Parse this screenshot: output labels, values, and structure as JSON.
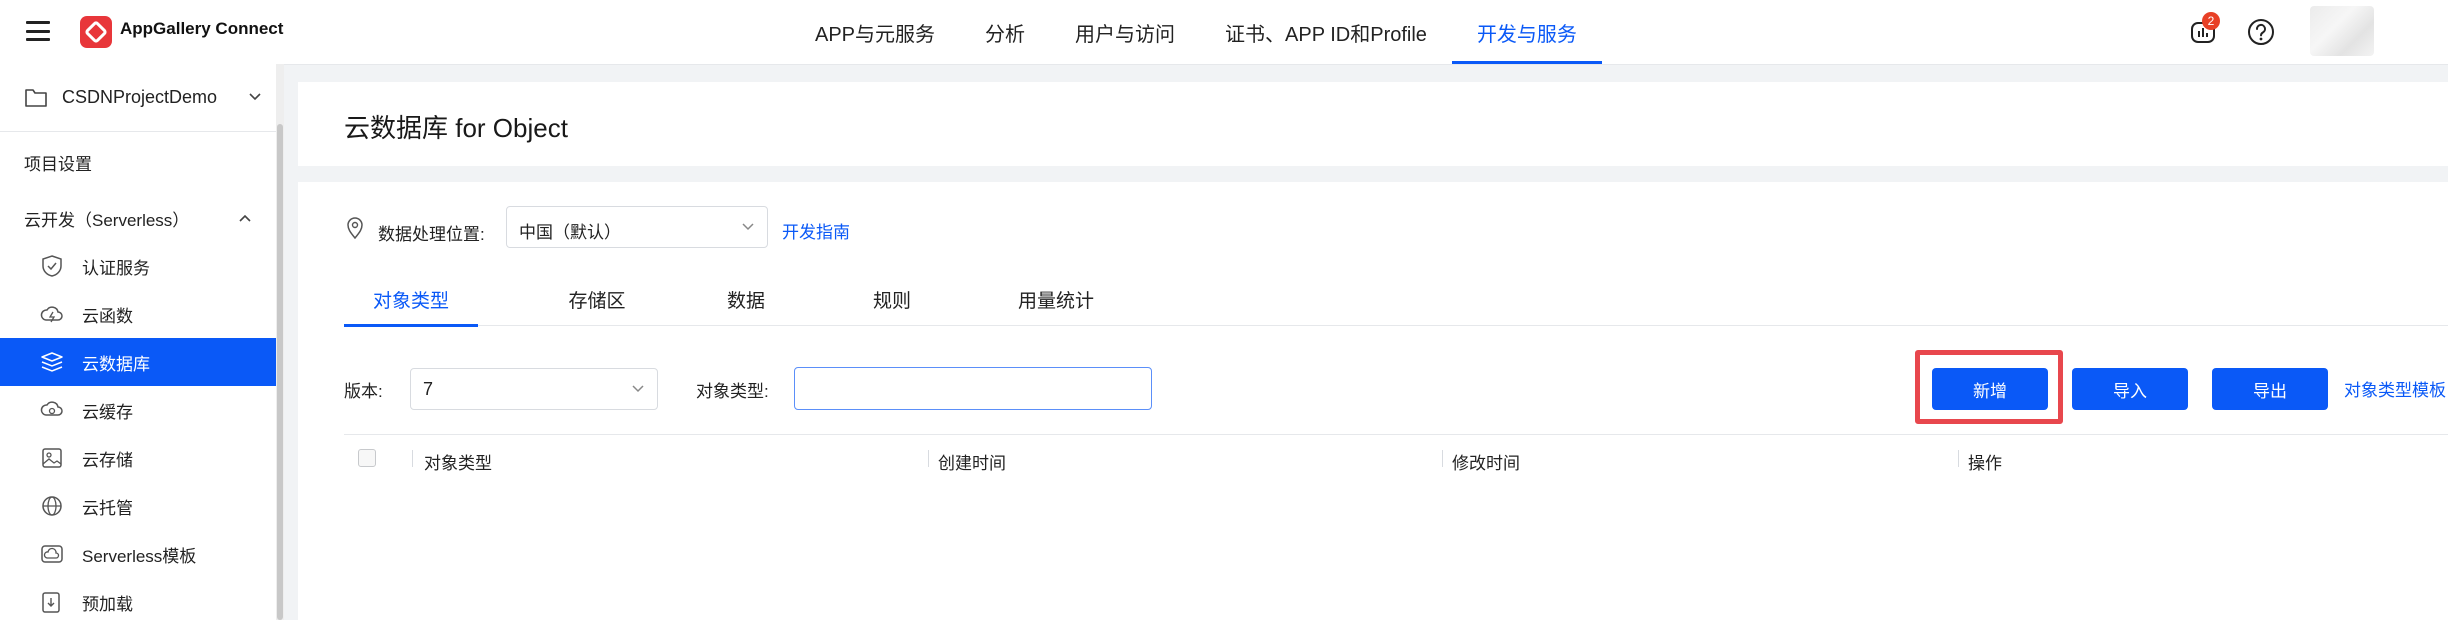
{
  "header": {
    "brand": "AppGallery Connect",
    "nav": [
      {
        "label": "APP与元服务",
        "active": false
      },
      {
        "label": "分析",
        "active": false
      },
      {
        "label": "用户与访问",
        "active": false
      },
      {
        "label": "证书、APP ID和Profile",
        "active": false
      },
      {
        "label": "开发与服务",
        "active": true
      }
    ],
    "notification_count": "2",
    "icons": [
      "menu-icon",
      "appgallery-logo",
      "notification-icon",
      "help-icon"
    ],
    "accent_color": "#0a59f7"
  },
  "sidebar": {
    "project": "CSDNProjectDemo",
    "items": [
      {
        "label": "项目设置",
        "level": "top"
      },
      {
        "label": "云开发（Serverless）",
        "level": "top",
        "expanded": true
      },
      {
        "label": "认证服务",
        "icon": "shield-check-icon"
      },
      {
        "label": "云函数",
        "icon": "cloud-function-icon"
      },
      {
        "label": "云数据库",
        "icon": "database-layers-icon",
        "active": true
      },
      {
        "label": "云缓存",
        "icon": "cloud-cache-icon"
      },
      {
        "label": "云存储",
        "icon": "image-storage-icon"
      },
      {
        "label": "云托管",
        "icon": "globe-hosting-icon"
      },
      {
        "label": "Serverless模板",
        "icon": "cloud-template-icon"
      },
      {
        "label": "预加载",
        "icon": "preload-icon"
      }
    ]
  },
  "main": {
    "title": "云数据库 for Object",
    "location_label": "数据处理位置:",
    "location_value": "中国（默认）",
    "dev_guide": "开发指南",
    "tabs": [
      {
        "label": "对象类型",
        "active": true
      },
      {
        "label": "存储区"
      },
      {
        "label": "数据"
      },
      {
        "label": "规则"
      },
      {
        "label": "用量统计"
      }
    ],
    "version_label": "版本:",
    "version_value": "7",
    "type_label": "对象类型:",
    "type_value": "",
    "buttons": {
      "add": "新增",
      "import": "导入",
      "export": "导出"
    },
    "template_link": "对象类型模板",
    "table_headers": [
      "对象类型",
      "创建时间",
      "修改时间",
      "操作"
    ],
    "highlight_color": "#e8474d"
  }
}
